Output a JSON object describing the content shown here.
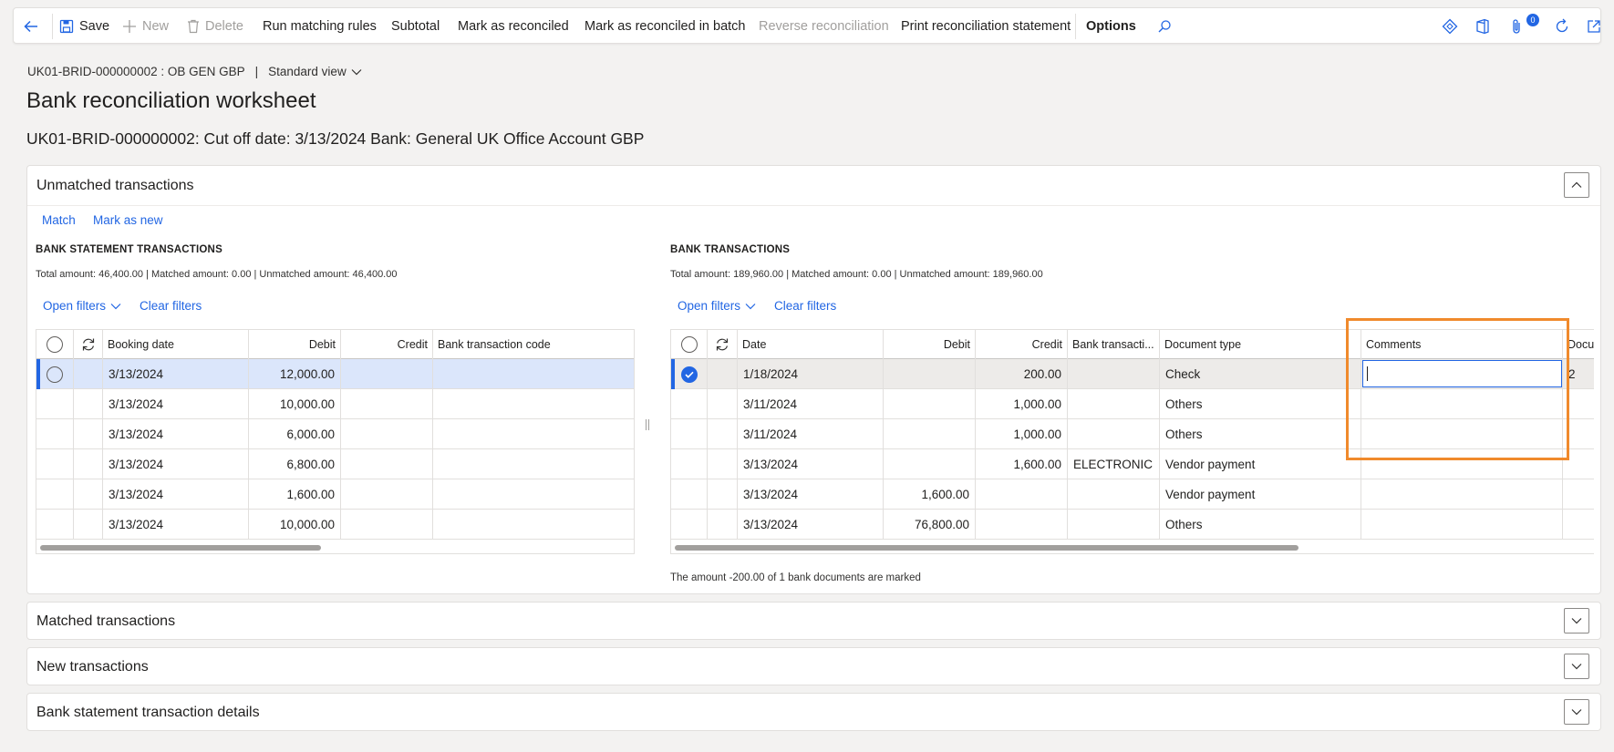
{
  "toolbar": {
    "save": "Save",
    "new": "New",
    "delete": "Delete",
    "run_matching_rules": "Run matching rules",
    "subtotal": "Subtotal",
    "mark_as_reconciled": "Mark as reconciled",
    "mark_as_reconciled_batch": "Mark as reconciled in batch",
    "reverse_reconciliation": "Reverse reconciliation",
    "print_statement": "Print reconciliation statement",
    "options": "Options",
    "notification_count": "0"
  },
  "header": {
    "breadcrumb": "UK01-BRID-000000002 : OB GEN GBP",
    "separator": "|",
    "view": "Standard view",
    "title": "Bank reconciliation worksheet",
    "subtitle": "UK01-BRID-000000002: Cut off date: 3/13/2024 Bank: General UK Office Account GBP"
  },
  "unmatched": {
    "title": "Unmatched transactions",
    "actions": {
      "match": "Match",
      "mark_as_new": "Mark as new"
    },
    "statement": {
      "title": "BANK STATEMENT TRANSACTIONS",
      "summary": "Total amount: 46,400.00 | Matched amount: 0.00 | Unmatched amount: 46,400.00",
      "open_filters": "Open filters",
      "clear_filters": "Clear filters",
      "columns": [
        "Booking date",
        "Debit",
        "Credit",
        "Bank transaction code"
      ],
      "rows": [
        [
          "3/13/2024",
          "12,000.00",
          "",
          ""
        ],
        [
          "3/13/2024",
          "10,000.00",
          "",
          ""
        ],
        [
          "3/13/2024",
          "6,000.00",
          "",
          ""
        ],
        [
          "3/13/2024",
          "6,800.00",
          "",
          ""
        ],
        [
          "3/13/2024",
          "1,600.00",
          "",
          ""
        ],
        [
          "3/13/2024",
          "10,000.00",
          "",
          ""
        ]
      ]
    },
    "bank": {
      "title": "BANK TRANSACTIONS",
      "summary": "Total amount: 189,960.00 | Matched amount: 0.00 | Unmatched amount: 189,960.00",
      "open_filters": "Open filters",
      "clear_filters": "Clear filters",
      "columns": [
        "Date",
        "Debit",
        "Credit",
        "Bank transacti...",
        "Document type",
        "Comments",
        "Docu"
      ],
      "rows": [
        [
          "1/18/2024",
          "",
          "200.00",
          "",
          "Check",
          "",
          "2"
        ],
        [
          "3/11/2024",
          "",
          "1,000.00",
          "",
          "Others",
          "",
          ""
        ],
        [
          "3/11/2024",
          "",
          "1,000.00",
          "",
          "Others",
          "",
          ""
        ],
        [
          "3/13/2024",
          "",
          "1,600.00",
          "ELECTRONIC",
          "Vendor payment",
          "",
          ""
        ],
        [
          "3/13/2024",
          "1,600.00",
          "",
          "",
          "Vendor payment",
          "",
          ""
        ],
        [
          "3/13/2024",
          "76,800.00",
          "",
          "",
          "Others",
          "",
          ""
        ]
      ],
      "footer": "The amount -200.00 of 1 bank documents are marked"
    }
  },
  "sections": {
    "matched": "Matched transactions",
    "new": "New transactions",
    "details": "Bank statement transaction details"
  },
  "colors": {
    "accent": "#2266e3",
    "highlight": "#f08a2c"
  }
}
